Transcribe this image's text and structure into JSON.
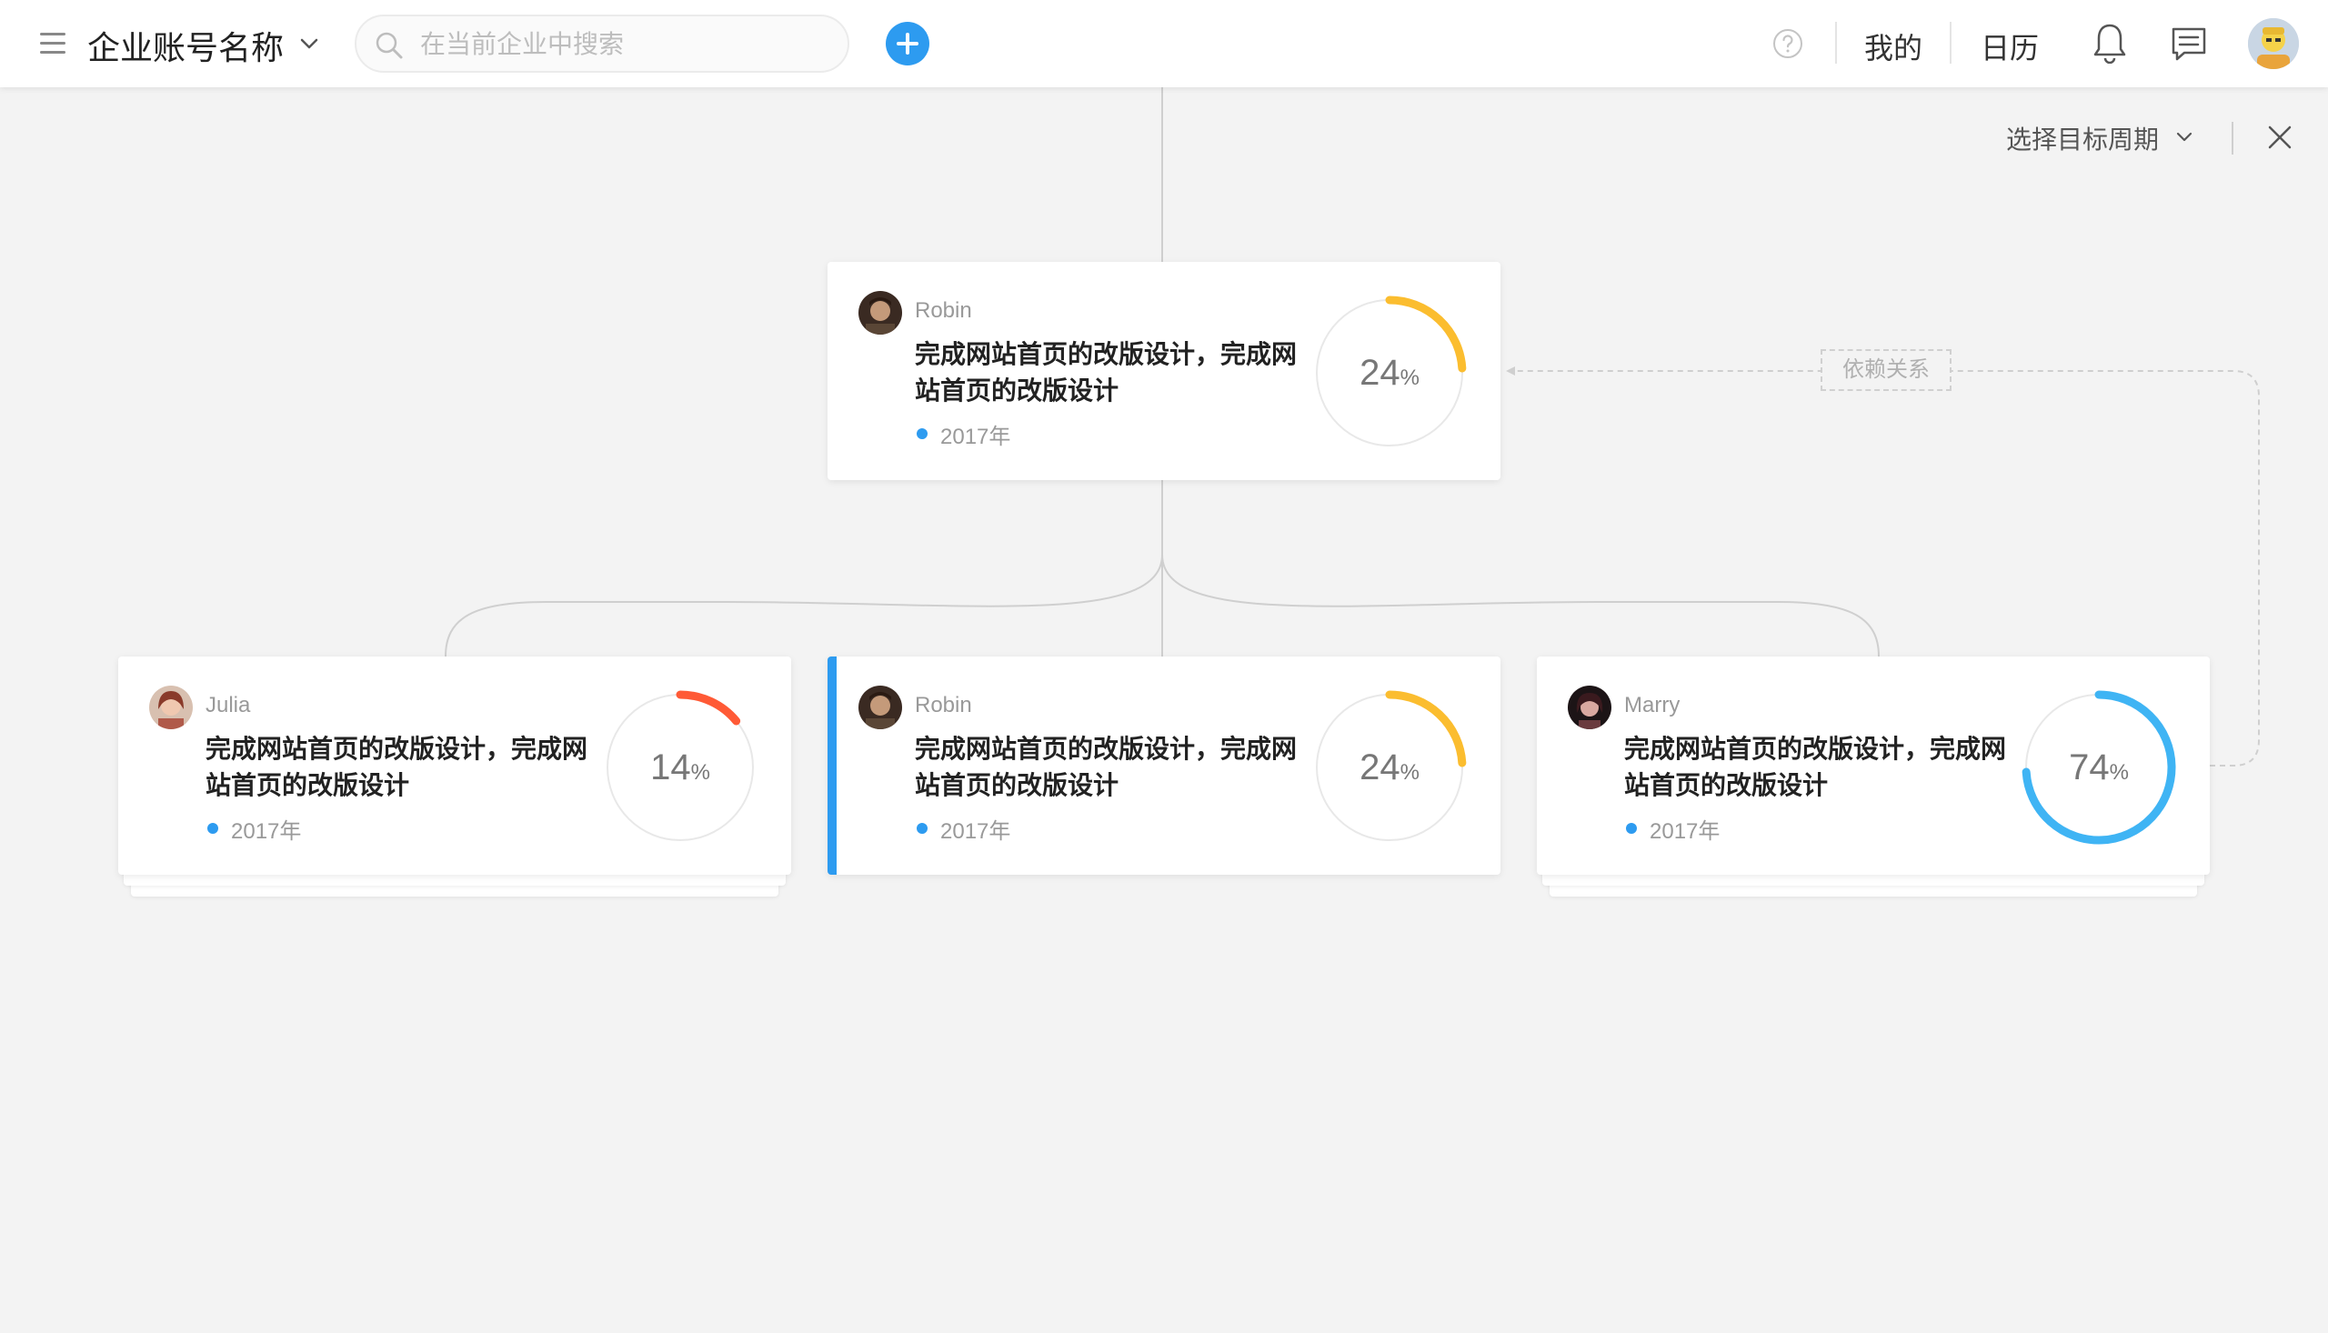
{
  "header": {
    "company_name": "企业账号名称",
    "search_placeholder": "在当前企业中搜索",
    "nav": {
      "mine": "我的",
      "calendar": "日历"
    }
  },
  "toolbar": {
    "period_select": "选择目标周期"
  },
  "dependency_label": "依赖关系",
  "colors": {
    "accent": "#2d9bf0",
    "progress_yellow": "#fbbd2f",
    "progress_red": "#ff5a36",
    "progress_blue": "#3fb4f4",
    "track": "#e8e8e8"
  },
  "cards": [
    {
      "owner": "Robin",
      "title": "完成网站首页的改版设计，完成网站首页的改版设计",
      "year": "2017年",
      "progress": 24,
      "percent_sign": "%",
      "ring_color": "#fbbd2f"
    },
    {
      "owner": "Julia",
      "title": "完成网站首页的改版设计，完成网站首页的改版设计",
      "year": "2017年",
      "progress": 14,
      "percent_sign": "%",
      "ring_color": "#ff5a36"
    },
    {
      "owner": "Robin",
      "title": "完成网站首页的改版设计，完成网站首页的改版设计",
      "year": "2017年",
      "progress": 24,
      "percent_sign": "%",
      "ring_color": "#fbbd2f"
    },
    {
      "owner": "Marry",
      "title": "完成网站首页的改版设计，完成网站首页的改版设计",
      "year": "2017年",
      "progress": 74,
      "percent_sign": "%",
      "ring_color": "#3fb4f4"
    }
  ]
}
